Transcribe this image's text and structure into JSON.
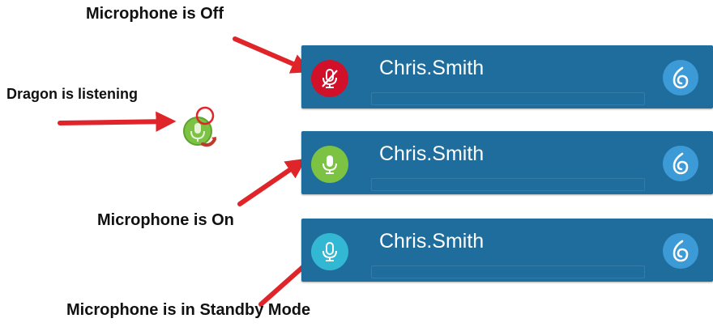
{
  "colors": {
    "bar": "#1f6d9c",
    "mic_off": "#d1102a",
    "mic_on": "#7cc243",
    "mic_standby": "#33b8d4",
    "dragon_badge": "#3c9ad6",
    "arrow": "#e0252a"
  },
  "captions": {
    "mic_off": "Microphone is Off",
    "listening": "Dragon is listening",
    "mic_on": "Microphone is On",
    "standby": "Microphone is in Standby Mode"
  },
  "bars": [
    {
      "state": "off",
      "user": "Chris.Smith",
      "mic_icon": "microphone-muted-icon",
      "dragon_icon": "dragon-flame-icon"
    },
    {
      "state": "on",
      "user": "Chris.Smith",
      "mic_icon": "microphone-icon",
      "dragon_icon": "dragon-flame-icon"
    },
    {
      "state": "standby",
      "user": "Chris.Smith",
      "mic_icon": "microphone-icon",
      "dragon_icon": "dragon-flame-icon"
    }
  ],
  "listening_indicator": {
    "icon": "dragon-listening-icon"
  }
}
